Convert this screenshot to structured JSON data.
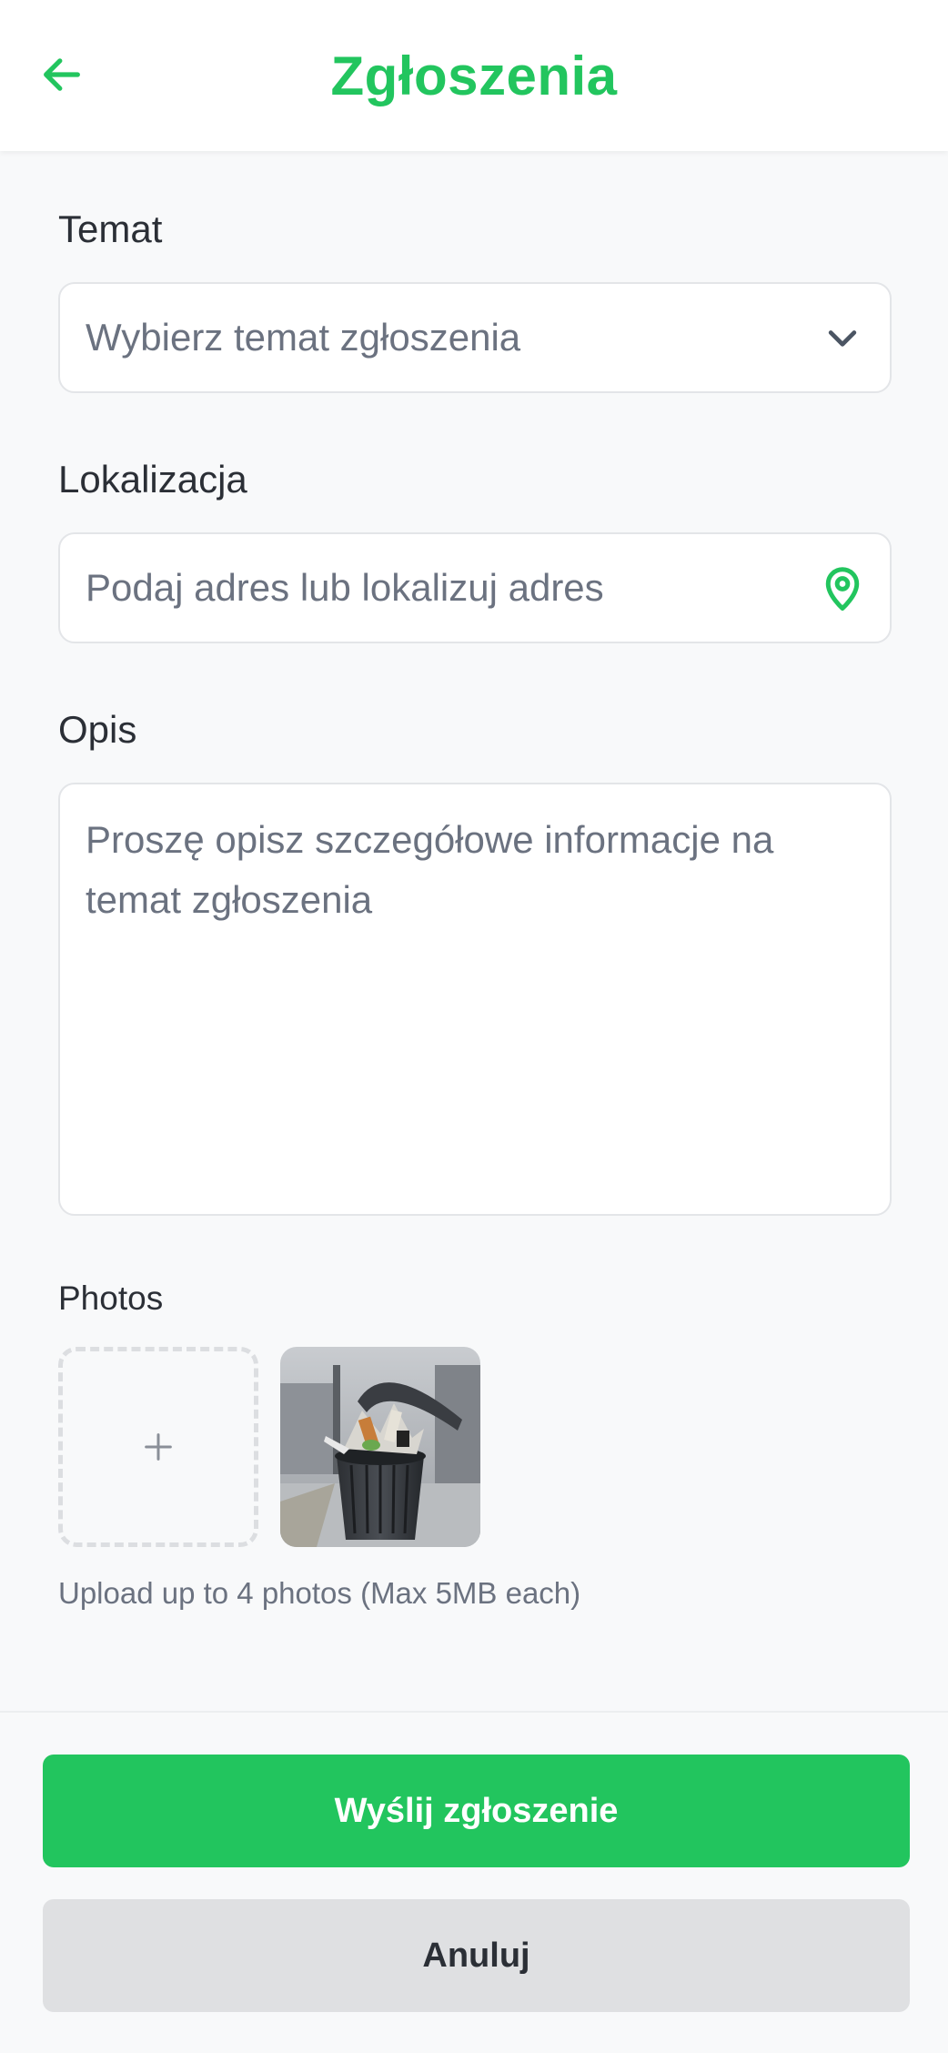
{
  "header": {
    "title": "Zgłoszenia",
    "back_icon": "arrow-left-icon"
  },
  "form": {
    "topic": {
      "label": "Temat",
      "placeholder": "Wybierz temat zgłoszenia",
      "icon": "chevron-down-icon"
    },
    "location": {
      "label": "Lokalizacja",
      "placeholder": "Podaj adres lub lokalizuj adres",
      "icon": "map-pin-icon"
    },
    "description": {
      "label": "Opis",
      "placeholder": "Proszę opisz szczegółowe informacje na temat zgłoszenia"
    },
    "photos": {
      "label": "Photos",
      "add_icon": "plus-icon",
      "items": [
        {
          "kind": "photo",
          "subject": "overflowing trash can on a street"
        }
      ],
      "hint": "Upload up to 4 photos (Max 5MB each)"
    }
  },
  "actions": {
    "submit_label": "Wyślij zgłoszenie",
    "cancel_label": "Anuluj"
  },
  "colors": {
    "accent": "#22c55e",
    "background": "#f8f9fa",
    "text": "#2b2f36",
    "placeholder": "#6b7280",
    "cancel_bg": "#dfe0e2"
  }
}
